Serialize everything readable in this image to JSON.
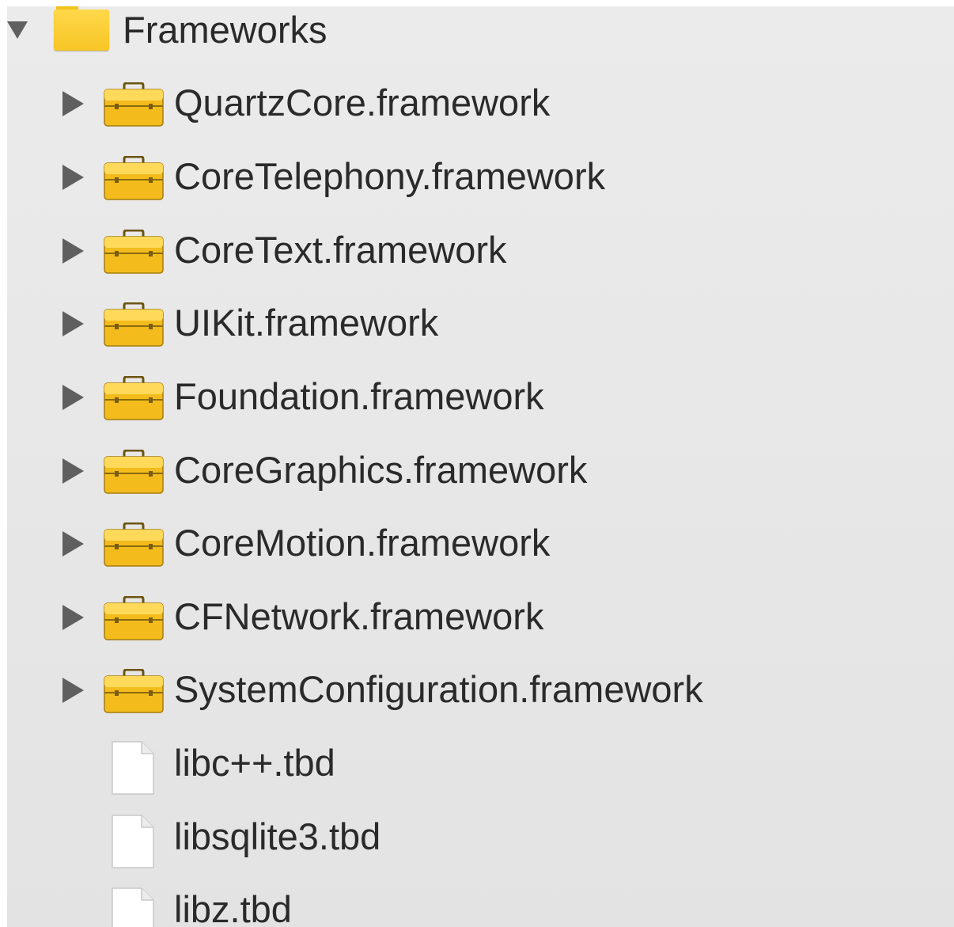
{
  "group": {
    "name": "Frameworks",
    "icon": "folder-icon",
    "expanded": true,
    "color": "#f7c526"
  },
  "frameworks": [
    {
      "name": "QuartzCore.framework",
      "icon": "briefcase-icon"
    },
    {
      "name": "CoreTelephony.framework",
      "icon": "briefcase-icon"
    },
    {
      "name": "CoreText.framework",
      "icon": "briefcase-icon"
    },
    {
      "name": "UIKit.framework",
      "icon": "briefcase-icon"
    },
    {
      "name": "Foundation.framework",
      "icon": "briefcase-icon"
    },
    {
      "name": "CoreGraphics.framework",
      "icon": "briefcase-icon"
    },
    {
      "name": "CoreMotion.framework",
      "icon": "briefcase-icon"
    },
    {
      "name": "CFNetwork.framework",
      "icon": "briefcase-icon"
    },
    {
      "name": "SystemConfiguration.framework",
      "icon": "briefcase-icon"
    }
  ],
  "files": [
    {
      "name": "libc++.tbd",
      "icon": "file-icon"
    },
    {
      "name": "libsqlite3.tbd",
      "icon": "file-icon"
    },
    {
      "name": "libz.tbd",
      "icon": "file-icon"
    }
  ]
}
